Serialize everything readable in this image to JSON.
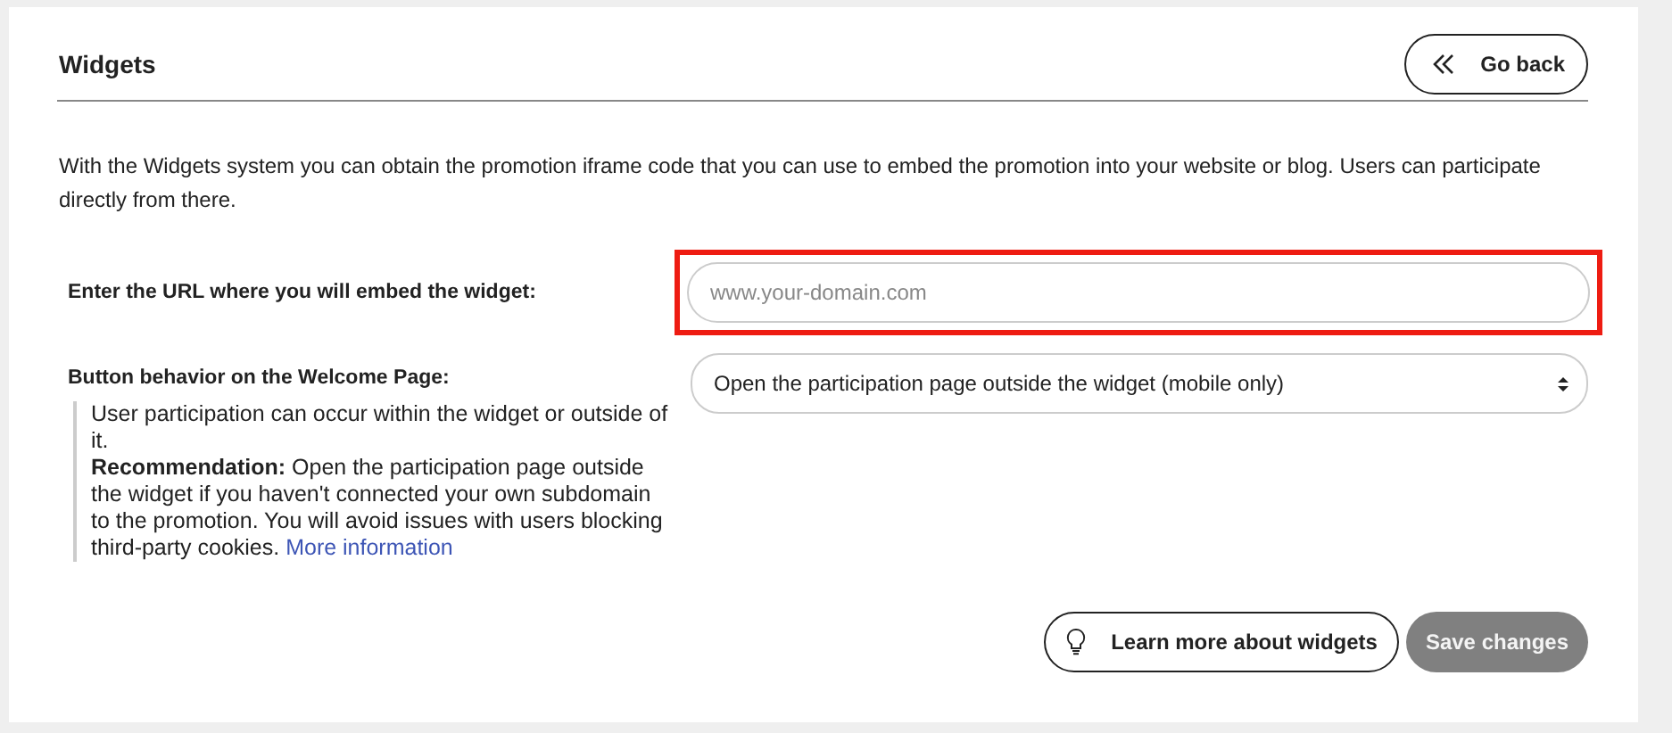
{
  "header": {
    "title": "Widgets",
    "back_button": {
      "label": "Go back"
    }
  },
  "description": "With the Widgets system you can obtain the promotion iframe code that you can use to embed the promotion into your website or blog. Users can participate directly from there.",
  "url_field": {
    "label": "Enter the URL where you will embed the widget:",
    "placeholder": "www.your-domain.com",
    "highlighted": true
  },
  "behavior_field": {
    "label": "Button behavior on the Welcome Page:",
    "value": "Open the participation page outside the widget (mobile only)",
    "help": [
      "User participation can occur within the widget or outside of it.",
      "**Recommendation:** Open the participation page outside the widget if you haven't connected your own subdomain to the promotion. You will avoid issues with users blocking third-party cookies."
    ],
    "help_link": "More information"
  },
  "buttons": [
    {
      "kind": "outline",
      "label": "Learn more about widgets",
      "disabled": false
    },
    {
      "kind": "filled",
      "label": "Save changes",
      "disabled": true
    }
  ]
}
